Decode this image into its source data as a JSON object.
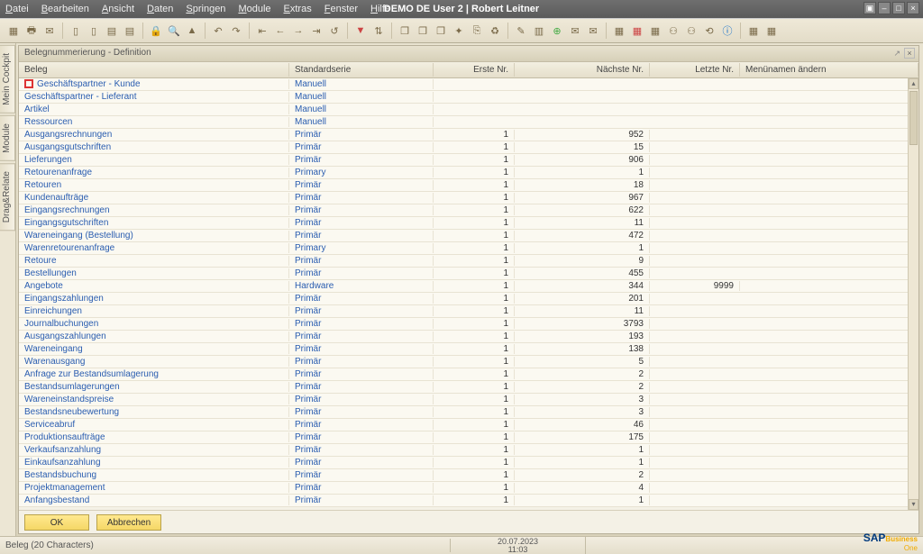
{
  "app_title": "DEMO DE User 2 | Robert Leitner",
  "menus": [
    "Datei",
    "Bearbeiten",
    "Ansicht",
    "Daten",
    "Springen",
    "Module",
    "Extras",
    "Fenster",
    "Hilfe"
  ],
  "side_tabs": [
    "Mein Cockpit",
    "Module",
    "Drag&Relate"
  ],
  "window_title": "Belegnummerierung - Definition",
  "columns": {
    "beleg": "Beleg",
    "serie": "Standardserie",
    "erste": "Erste Nr.",
    "naechste": "Nächste Nr.",
    "letzte": "Letzte Nr.",
    "menu": "Menünamen ändern"
  },
  "rows": [
    {
      "beleg": "Geschäftspartner - Kunde",
      "serie": "Manuell",
      "erste": "",
      "naechste": "",
      "letzte": "",
      "redbox": true
    },
    {
      "beleg": "Geschäftspartner - Lieferant",
      "serie": "Manuell",
      "erste": "",
      "naechste": "",
      "letzte": ""
    },
    {
      "beleg": "Artikel",
      "serie": "Manuell",
      "erste": "",
      "naechste": "",
      "letzte": ""
    },
    {
      "beleg": "Ressourcen",
      "serie": "Manuell",
      "erste": "",
      "naechste": "",
      "letzte": ""
    },
    {
      "beleg": "Ausgangsrechnungen",
      "serie": "Primär",
      "erste": "1",
      "naechste": "952",
      "letzte": ""
    },
    {
      "beleg": "Ausgangsgutschriften",
      "serie": "Primär",
      "erste": "1",
      "naechste": "15",
      "letzte": ""
    },
    {
      "beleg": "Lieferungen",
      "serie": "Primär",
      "erste": "1",
      "naechste": "906",
      "letzte": ""
    },
    {
      "beleg": "Retourenanfrage",
      "serie": "Primary",
      "erste": "1",
      "naechste": "1",
      "letzte": ""
    },
    {
      "beleg": "Retouren",
      "serie": "Primär",
      "erste": "1",
      "naechste": "18",
      "letzte": ""
    },
    {
      "beleg": "Kundenaufträge",
      "serie": "Primär",
      "erste": "1",
      "naechste": "967",
      "letzte": ""
    },
    {
      "beleg": "Eingangsrechnungen",
      "serie": "Primär",
      "erste": "1",
      "naechste": "622",
      "letzte": ""
    },
    {
      "beleg": "Eingangsgutschriften",
      "serie": "Primär",
      "erste": "1",
      "naechste": "11",
      "letzte": ""
    },
    {
      "beleg": "Wareneingang (Bestellung)",
      "serie": "Primär",
      "erste": "1",
      "naechste": "472",
      "letzte": ""
    },
    {
      "beleg": "Warenretourenanfrage",
      "serie": "Primary",
      "erste": "1",
      "naechste": "1",
      "letzte": ""
    },
    {
      "beleg": "Retoure",
      "serie": "Primär",
      "erste": "1",
      "naechste": "9",
      "letzte": ""
    },
    {
      "beleg": "Bestellungen",
      "serie": "Primär",
      "erste": "1",
      "naechste": "455",
      "letzte": ""
    },
    {
      "beleg": "Angebote",
      "serie": "Hardware",
      "erste": "1",
      "naechste": "344",
      "letzte": "9999"
    },
    {
      "beleg": "Eingangszahlungen",
      "serie": "Primär",
      "erste": "1",
      "naechste": "201",
      "letzte": ""
    },
    {
      "beleg": "Einreichungen",
      "serie": "Primär",
      "erste": "1",
      "naechste": "11",
      "letzte": ""
    },
    {
      "beleg": "Journalbuchungen",
      "serie": "Primär",
      "erste": "1",
      "naechste": "3793",
      "letzte": ""
    },
    {
      "beleg": "Ausgangszahlungen",
      "serie": "Primär",
      "erste": "1",
      "naechste": "193",
      "letzte": ""
    },
    {
      "beleg": "Wareneingang",
      "serie": "Primär",
      "erste": "1",
      "naechste": "138",
      "letzte": ""
    },
    {
      "beleg": "Warenausgang",
      "serie": "Primär",
      "erste": "1",
      "naechste": "5",
      "letzte": ""
    },
    {
      "beleg": "Anfrage zur Bestandsumlagerung",
      "serie": "Primär",
      "erste": "1",
      "naechste": "2",
      "letzte": ""
    },
    {
      "beleg": "Bestandsumlagerungen",
      "serie": "Primär",
      "erste": "1",
      "naechste": "2",
      "letzte": ""
    },
    {
      "beleg": "Wareneinstandspreise",
      "serie": "Primär",
      "erste": "1",
      "naechste": "3",
      "letzte": ""
    },
    {
      "beleg": "Bestandsneubewertung",
      "serie": "Primär",
      "erste": "1",
      "naechste": "3",
      "letzte": ""
    },
    {
      "beleg": "Serviceabruf",
      "serie": "Primär",
      "erste": "1",
      "naechste": "46",
      "letzte": ""
    },
    {
      "beleg": "Produktionsaufträge",
      "serie": "Primär",
      "erste": "1",
      "naechste": "175",
      "letzte": ""
    },
    {
      "beleg": "Verkaufsanzahlung",
      "serie": "Primär",
      "erste": "1",
      "naechste": "1",
      "letzte": ""
    },
    {
      "beleg": "Einkaufsanzahlung",
      "serie": "Primär",
      "erste": "1",
      "naechste": "1",
      "letzte": ""
    },
    {
      "beleg": "Bestandsbuchung",
      "serie": "Primär",
      "erste": "1",
      "naechste": "2",
      "letzte": ""
    },
    {
      "beleg": "Projektmanagement",
      "serie": "Primär",
      "erste": "1",
      "naechste": "4",
      "letzte": ""
    },
    {
      "beleg": "Anfangsbestand",
      "serie": "Primär",
      "erste": "1",
      "naechste": "1",
      "letzte": ""
    }
  ],
  "buttons": {
    "ok": "OK",
    "cancel": "Abbrechen"
  },
  "status": {
    "left": "Beleg (20 Characters)",
    "date": "20.07.2023",
    "time": "11:03"
  },
  "logo": {
    "brand": "SAP",
    "sub": "Business",
    "one": "One"
  }
}
